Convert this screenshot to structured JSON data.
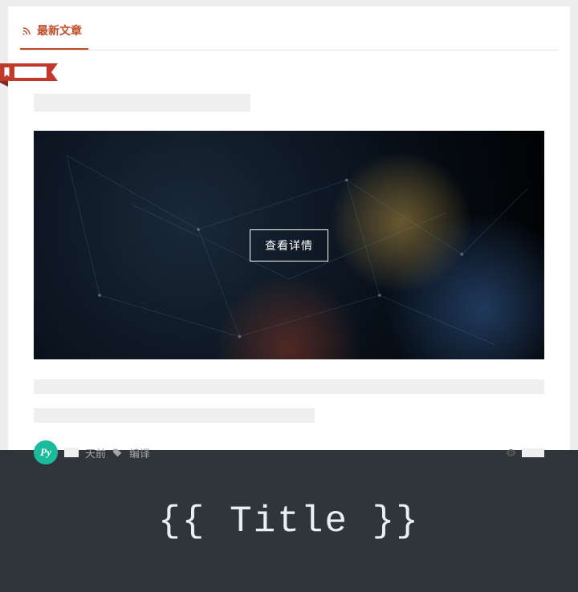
{
  "tab": {
    "label": "最新文章"
  },
  "ribbon": {
    "label": ""
  },
  "article": {
    "view_button": "查看详情",
    "avatar_text": "Py",
    "time_suffix": "天前",
    "category": "编译"
  },
  "footer": {
    "title": "{{ Title }}"
  }
}
